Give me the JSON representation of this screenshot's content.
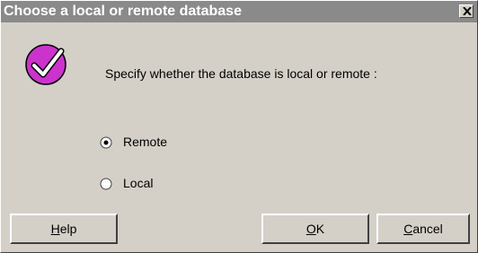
{
  "dialog": {
    "title": "Choose a local or remote database",
    "prompt": "Specify whether the database is local or remote :"
  },
  "options": [
    {
      "label": "Remote",
      "selected": true
    },
    {
      "label": "Local",
      "selected": false
    }
  ],
  "buttons": {
    "help": {
      "mnemonic": "H",
      "rest": "elp"
    },
    "ok": {
      "mnemonic": "O",
      "rest": "K"
    },
    "cancel": {
      "mnemonic": "C",
      "rest": "ancel"
    }
  },
  "icons": {
    "title_close": "close-icon",
    "prompt_icon": "checkmark-icon"
  },
  "colors": {
    "titlebar": "#8a8a8a",
    "dialog_bg": "#d4d0c8",
    "check_icon": "#cc33cc"
  }
}
